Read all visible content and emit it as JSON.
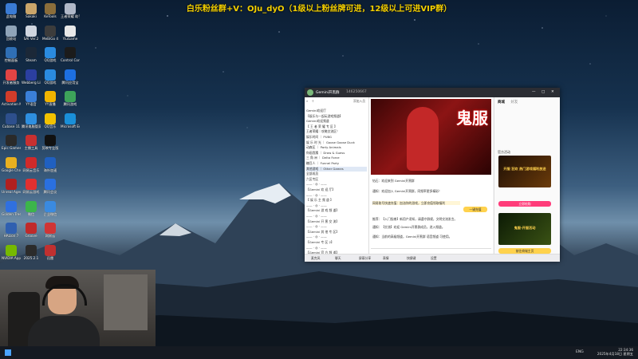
{
  "stream_banner": "白乐粉丝群+V：OJu_dyO（1级以上粉丝牌可进，12级以上可进VIP群）",
  "desktop_icons": [
    {
      "label": "此电脑",
      "color": "#3a7bd5"
    },
    {
      "label": "Sakaki",
      "color": "#caa56a"
    },
    {
      "label": "KeTools",
      "color": "#8a6d3b"
    },
    {
      "label": "王者荣耀 助手",
      "color": "#b0b8c8"
    },
    {
      "label": "回收站",
      "color": "#8fa3b8"
    },
    {
      "label": "SAI Ver.2",
      "color": "#d0d6e0"
    },
    {
      "label": "MeBiGo 4",
      "color": "#3c3c3c"
    },
    {
      "label": "YiuGame",
      "color": "#e8e8e8"
    },
    {
      "label": "控制面板",
      "color": "#2f6fb5"
    },
    {
      "label": "Steam",
      "color": "#1b2838"
    },
    {
      "label": "QQ游戏",
      "color": "#2a8be0"
    },
    {
      "label": "Control Control",
      "color": "#1b1b1b"
    },
    {
      "label": "开发者服务",
      "color": "#e04444"
    },
    {
      "label": "Webberg Library",
      "color": "#2b3fa0"
    },
    {
      "label": "QQ游戏",
      "color": "#2a8be0"
    },
    {
      "label": "腾讯应用宝",
      "color": "#1d6fe0"
    },
    {
      "label": "Activation Manager",
      "color": "#d03c2a"
    },
    {
      "label": "YY语音",
      "color": "#3a7fd8"
    },
    {
      "label": "YY直播",
      "color": "#f0b400"
    },
    {
      "label": "腾讯游戏",
      "color": "#3da35a"
    },
    {
      "label": "Cubase 11",
      "color": "#2d4f8c"
    },
    {
      "label": "腾讯电脑管家",
      "color": "#2e8fe0"
    },
    {
      "label": "QQ音乐",
      "color": "#f2c200"
    },
    {
      "label": "Microsoft Edge",
      "color": "#1a8fd8"
    },
    {
      "label": "Epic Games Launcher",
      "color": "#2a2a2a"
    },
    {
      "label": "主播工具",
      "color": "#c83030"
    },
    {
      "label": "剪映专业版",
      "color": "#111111"
    },
    {
      "label": "",
      "color": "#000000"
    },
    {
      "label": "Google Chrome",
      "color": "#e8b020"
    },
    {
      "label": "网易云音乐",
      "color": "#d02a2a"
    },
    {
      "label": "海外加速",
      "color": "#2060c0"
    },
    {
      "label": "",
      "color": "#000000"
    },
    {
      "label": "Unreal Agent 11",
      "color": "#b02020"
    },
    {
      "label": "网易云游戏",
      "color": "#e03030"
    },
    {
      "label": "腾讯会议",
      "color": "#2a70e0"
    },
    {
      "label": "",
      "color": "#000000"
    },
    {
      "label": "Golden Tree",
      "color": "#3070e0"
    },
    {
      "label": "微信",
      "color": "#3cb54a"
    },
    {
      "label": "企业微信",
      "color": "#3a8ae0"
    },
    {
      "label": "",
      "color": "#000000"
    },
    {
      "label": "HALion 7",
      "color": "#3060b0"
    },
    {
      "label": "Groove",
      "color": "#c02a2a"
    },
    {
      "label": "网易云",
      "color": "#d03535"
    },
    {
      "label": "",
      "color": "#000000"
    },
    {
      "label": "NVIDIA App",
      "color": "#76b900"
    },
    {
      "label": "2025.2.1",
      "color": "#2b2b2b"
    },
    {
      "label": "迅雷",
      "color": "#c03030"
    }
  ],
  "qq_window": {
    "title_user": "Gemini开黑群",
    "title_id": "146250667",
    "left_tabs": "添加入员",
    "channel_rows": [
      "Gemini欢迎厅",
      "【娱乐与一起玩游戏频道】",
      "Gemini欢迎频道",
      "【 王 者 荣 耀 专 区 】",
      "王者荣耀｜攻略交流区！",
      "娱乐时间 ｜ PUBG",
      "娱 乐 时 光 ｜ Goose Goose Duck",
      "动森区 ｜ Party Animals",
      "你画我猜 ｜ Draw & Guess",
      "三 角 洲 ｜ Delta Force",
      "糖豆人 ｜ Funnel Party",
      "其他游戏 ｜ Other Games",
      "全部成员",
      "六区专区",
      "—— · ◎ · ——",
      "【Gemini 欢 迎 厅】",
      "—— · ◎ · ——",
      "【 娱 乐 主 频 道 】",
      "—— · ◎ · ——",
      "【Gemini 游 戏 频 道】",
      "—— · ◎ · ——",
      "【Gemini 开 黑 交 流】",
      "—— · ◎ · ——",
      "【Gemini 其 他 专 区】",
      "—— · ◎ · ——",
      "【Gemini 专 区 2】",
      "—— · ◎ · ——",
      "【Gemini 官 方 频 道】"
    ],
    "mid_ad_text": "鬼服",
    "mid_messages": [
      "钻石：欢迎来到 Gemini开黑群",
      "通知：欢迎加入 Gemini开黑群，同频率更多精彩！",
      "网易账号快速充值：加油你的游戏，立即充值领取福利",
      "推荐：【入门指南】新用户须知，请遵守群规，文明交流发言。",
      "通知：【交流】欢迎 Gemini开黑群成员，进入频道。",
      "通知：当前的高级频道，Gemini开黑群 语音频道 可使用。"
    ],
    "mid_banner_btn": "一键充值",
    "bottom_bar": [
      "麦克风",
      "聊天",
      "屏幕分享",
      "表情",
      "快捷键",
      "设置"
    ],
    "right_tabs": [
      "商城",
      "好友"
    ],
    "right_section_title": "官方活动",
    "right_promo_1": "开服 狂欢 热门游戏福利放送",
    "right_promo_2": "鬼服-开服活动",
    "right_btn_1": "立即抢购",
    "right_btn_2": "前往商城主页",
    "right_note": "限时特惠 · 全网最低价"
  },
  "taskbar": {
    "lang": "ENG",
    "time": "22:34:36",
    "date": "2025年4月18日 星期五"
  }
}
